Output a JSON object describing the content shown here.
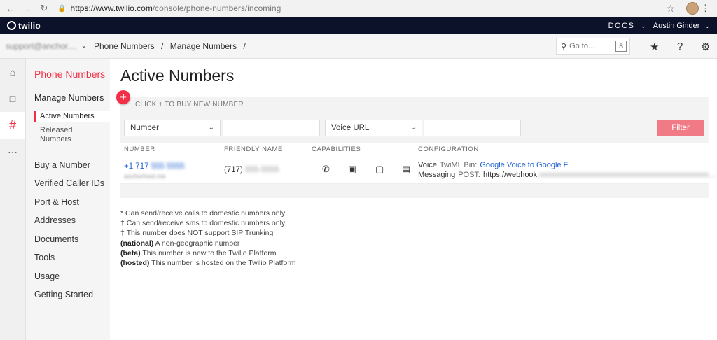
{
  "browser": {
    "url_prefix": "https://www.twilio.com",
    "url_path": "/console/phone-numbers/incoming",
    "back_icon": "arrow-left-icon",
    "forward_icon": "arrow-right-icon",
    "reload_icon": "reload-icon",
    "lock_icon": "lock-icon",
    "star_icon": "star-icon",
    "menu_icon": "kebab-icon"
  },
  "top_bar": {
    "logo_text": "twilio",
    "docs": "DOCS",
    "user": "Austin Ginder"
  },
  "crumb_bar": {
    "account": "support@anchor....",
    "crumbs": [
      "Phone Numbers",
      "/",
      "Manage Numbers",
      "/"
    ],
    "search_placeholder": "Go to...",
    "search_key": "S"
  },
  "sidebar": {
    "title": "Phone Numbers",
    "section": "Manage Numbers",
    "active_item": "Active Numbers",
    "released_item": "Released Numbers",
    "links": [
      "Buy a Number",
      "Verified Caller IDs",
      "Port & Host",
      "Addresses",
      "Documents",
      "Tools",
      "Usage",
      "Getting Started"
    ]
  },
  "main": {
    "title": "Active Numbers",
    "buy_text": "CLICK + TO BUY NEW NUMBER",
    "filter": {
      "field_select": "Number",
      "type_select": "Voice URL",
      "button": "Filter"
    },
    "columns": [
      "NUMBER",
      "FRIENDLY NAME",
      "CAPABILITIES",
      "CONFIGURATION"
    ],
    "rows": [
      {
        "number_prefix": "+1 717",
        "number_rest": "555 5555",
        "number_sub": "anchorhost.me",
        "friendly_prefix": "(717)",
        "friendly_rest": "555-5555",
        "voice_label": "Voice",
        "voice_kind": "TwiML Bin:",
        "voice_link": "Google Voice to Google Fi",
        "msg_label": "Messaging",
        "msg_kind": "POST:",
        "msg_url_prefix": "https://webhook.",
        "msg_url_rest": "xxxxxxxxxxxxxxxxxxxxxxxxxxxxxxxxxxxxxxxxxxxx..."
      }
    ],
    "notes": [
      {
        "mark": "*",
        "text": "Can send/receive calls to domestic numbers only"
      },
      {
        "mark": "†",
        "text": "Can send/receive sms to domestic numbers only"
      },
      {
        "mark": "‡",
        "text": "This number does NOT support SIP Trunking"
      },
      {
        "mark": "(national)",
        "text": "A non-geographic number"
      },
      {
        "mark": "(beta)",
        "text": "This number is new to the Twilio Platform"
      },
      {
        "mark": "(hosted)",
        "text": "This number is hosted on the Twilio Platform"
      }
    ]
  }
}
